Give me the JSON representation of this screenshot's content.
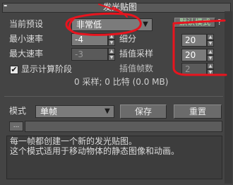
{
  "rollout": {
    "title": "发光贴图",
    "collapse_symbol": "-"
  },
  "preset": {
    "label": "当前预设",
    "selected": "非常低",
    "default_mode_label": "默认模式",
    "default_mode_help": "?"
  },
  "params": {
    "min_rate_label": "最小速率",
    "min_rate_value": "-4",
    "max_rate_label": "最大速率",
    "max_rate_value": "-3",
    "subdivs_label": "细分",
    "subdivs_value": "20",
    "interp_samples_label": "插值采样",
    "interp_samples_value": "20",
    "interp_frames_label": "插值帧数",
    "interp_frames_value": "2",
    "show_calc_label": "显示计算阶段",
    "show_calc_checked": "✔",
    "stats_text": "0 采样; 0 比特 (0.0 MB)"
  },
  "mode": {
    "label": "模式",
    "selected": "单帧",
    "save_label": "保存",
    "reset_label": "重置",
    "browse_label": "...",
    "path_value": ""
  },
  "description": {
    "text": "每一帧都创建一个新的发光贴图。\n这个模式适用于移动物体的静态图像和动画。"
  },
  "icons": {
    "dropdown": "chevron-down-icon",
    "spinner_up": "arrow-up-icon",
    "spinner_down": "arrow-down-icon"
  },
  "colors": {
    "panel_bg": "#444444",
    "field_bg": "#7b7b7b",
    "annotation_red": "#e8141e"
  }
}
